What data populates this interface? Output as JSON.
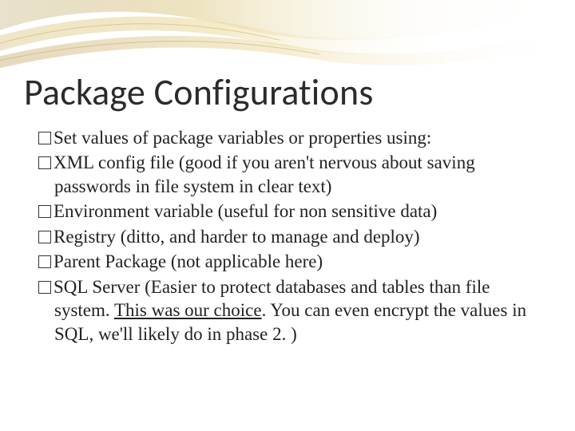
{
  "title": "Package Configurations",
  "bullets": [
    {
      "text": "Set values of package variables or properties using:"
    },
    {
      "text": "XML config file (good if you aren't nervous about saving passwords in file system in clear text)"
    },
    {
      "text": "Environment variable (useful for non sensitive data)"
    },
    {
      "text": "Registry (ditto, and harder to manage and deploy)"
    },
    {
      "text": "Parent Package (not applicable here)"
    },
    {
      "pre": "SQL Server (Easier to protect databases and tables than file system. ",
      "underline": "This was our choice",
      "post": ". You can even encrypt the values in SQL, we'll likely do in phase 2. )"
    }
  ]
}
